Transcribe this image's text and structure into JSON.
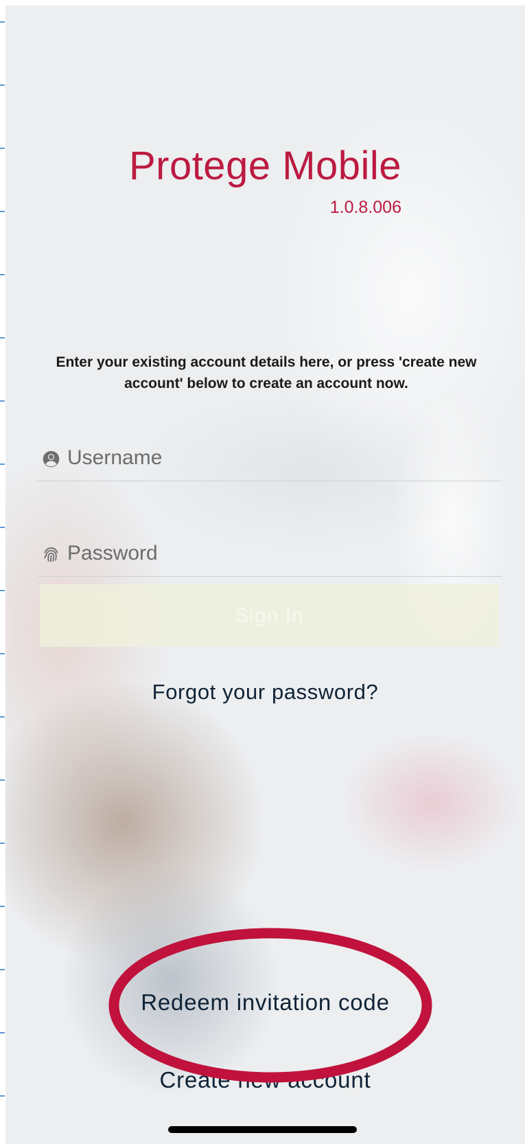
{
  "app": {
    "title": "Protege Mobile",
    "version": "1.0.8.006",
    "instructions": "Enter your existing account details here, or press 'create new account' below to create an account now."
  },
  "form": {
    "username": {
      "icon": "user-circle-icon",
      "placeholder": "Username",
      "value": ""
    },
    "password": {
      "icon": "fingerprint-icon",
      "placeholder": "Password",
      "value": ""
    },
    "signin_label": "Sign In",
    "forgot_label": "Forgot your password?"
  },
  "links": {
    "redeem_label": "Redeem invitation code",
    "create_label": "Create new account"
  },
  "colors": {
    "brand": "#bc1a41",
    "link": "#0f2336",
    "highlight": "#c0123c"
  }
}
